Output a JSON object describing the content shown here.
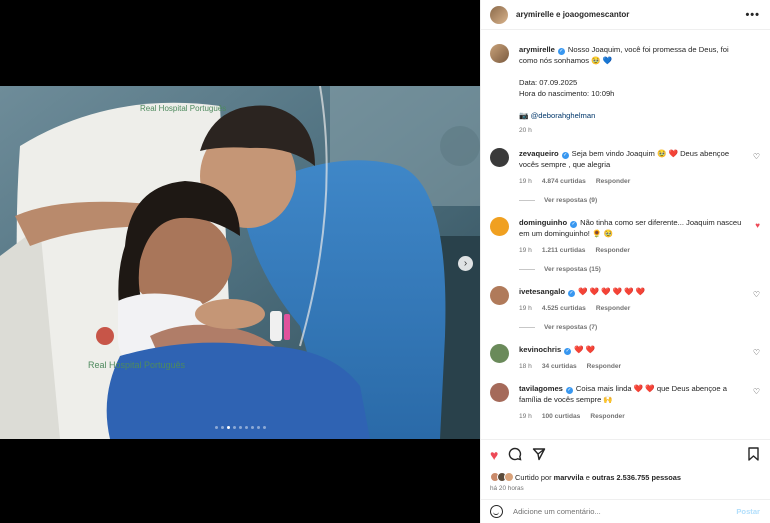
{
  "header": {
    "title": "arymirelle e joaogomescantor",
    "more_icon": "more-horizontal-icon"
  },
  "caption": {
    "username": "arymirelle",
    "text": "Nosso Joaquim, você foi promessa de Deus, foi como nós sonhamos 🥹 💙",
    "date_line": "Data: 07.09.2025",
    "time_line": "Hora do nascimento: 10:09h",
    "credit_prefix": "📷",
    "credit_handle": "@deborahghelman",
    "age": "20 h"
  },
  "comments": [
    {
      "username": "zevaqueiro",
      "verified": true,
      "text": "Seja bem vindo Joaquim 🥹 ❤️ Deus abençoe vocês sempre , que alegria",
      "time": "19 h",
      "likes": "4.874 curtidas",
      "reply": "Responder",
      "replies": "Ver respostas (9)",
      "liked": false,
      "avatar_color": "#3a3a3a"
    },
    {
      "username": "dominguinho",
      "verified": true,
      "text": "Não tinha como ser diferente... Joaquim nasceu em um dominguinho! 🌻 🥹",
      "time": "19 h",
      "likes": "1.211 curtidas",
      "reply": "Responder",
      "replies": "Ver respostas (15)",
      "liked": true,
      "avatar_color": "#f0a020"
    },
    {
      "username": "ivetesangalo",
      "verified": true,
      "text": "❤️ ❤️ ❤️ ❤️ ❤️ ❤️",
      "time": "19 h",
      "likes": "4.525 curtidas",
      "reply": "Responder",
      "replies": "Ver respostas (7)",
      "liked": false,
      "avatar_color": "#b07a5a"
    },
    {
      "username": "kevinochris",
      "verified": true,
      "text": "❤️ ❤️",
      "time": "18 h",
      "likes": "34 curtidas",
      "reply": "Responder",
      "replies": "",
      "liked": false,
      "avatar_color": "#6a8a5a"
    },
    {
      "username": "tavilagomes",
      "verified": true,
      "text": "Coisa mais linda ❤️ ❤️ que Deus abençoe a família de vocês sempre 🙌",
      "time": "19 h",
      "likes": "100 curtidas",
      "reply": "Responder",
      "replies": "",
      "liked": false,
      "avatar_color": "#a56a5a"
    }
  ],
  "likes": {
    "prefix": "Curtido por",
    "user": "marvvila",
    "middle": "e",
    "others": "outras 2.536.755 pessoas"
  },
  "post_time": "há 20 horas",
  "add_comment": {
    "placeholder": "Adicione um comentário...",
    "post_label": "Postar"
  },
  "carousel": {
    "total": 9,
    "active": 2
  },
  "photo": {
    "gown_text_top": "Real Hospital Português",
    "gown_text_mid": "Real Hospital Português"
  },
  "colors": {
    "liked": "#ed4956",
    "verified": "#3897f0",
    "link": "#00376b",
    "post_disabled": "#b2dffc"
  }
}
